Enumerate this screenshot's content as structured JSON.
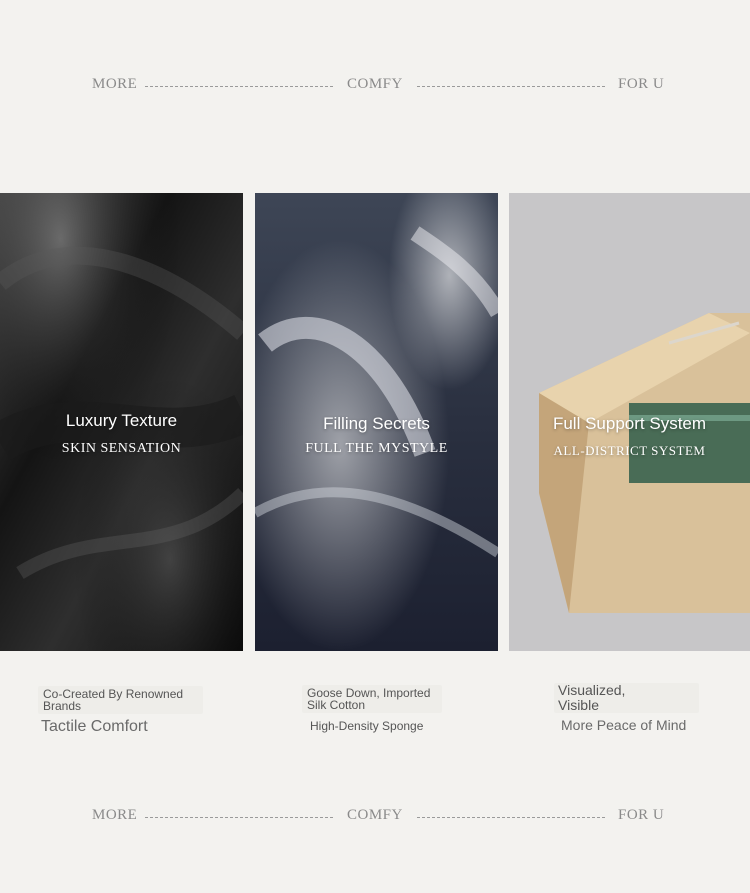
{
  "header": {
    "left": "MORE",
    "middle": "COMFY",
    "right": "FOR U"
  },
  "panels": [
    {
      "title": "Luxury Texture",
      "subtitle": "SKIN SENSATION",
      "image": "black-leather-image"
    },
    {
      "title": "Filling Secrets",
      "subtitle": "FULL THE MYSTYLE",
      "image": "feathers-image"
    },
    {
      "title": "Full Support System",
      "subtitle": "ALL-DISTRICT SYSTEM",
      "image": "wooden-frame-image"
    }
  ],
  "captions": [
    {
      "line1": "Co-Created By Renowned",
      "line2": "Brands",
      "main": "Tactile Comfort"
    },
    {
      "line1": "Goose Down, Imported",
      "line2": "Silk Cotton",
      "main": "High-Density Sponge"
    },
    {
      "line1": "Visualized,",
      "line2": "Visible",
      "main": "More Peace of Mind"
    }
  ],
  "footer": {
    "left": "MORE",
    "middle": "COMFY",
    "right": "FOR U"
  },
  "colors": {
    "background": "#f3f2ef",
    "divider_text": "#8a8a8a",
    "caption_text": "#555555"
  }
}
